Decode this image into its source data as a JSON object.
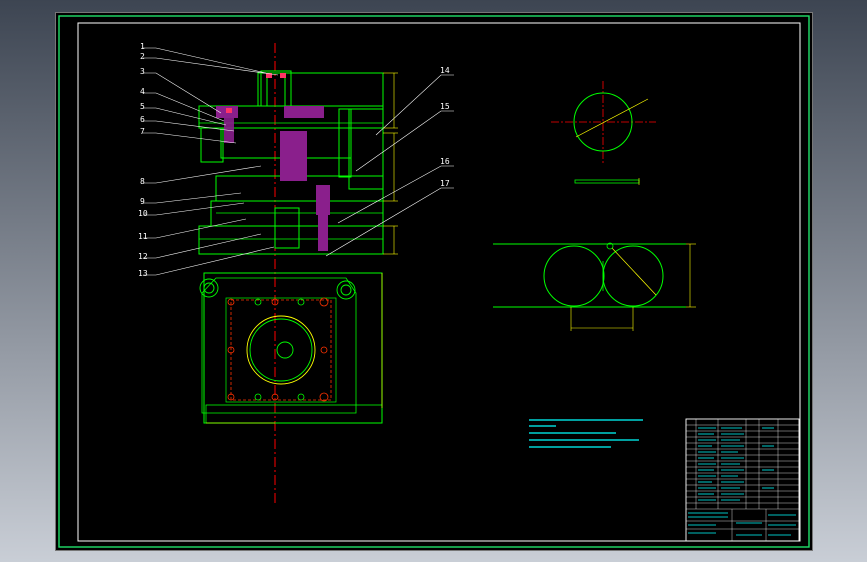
{
  "part_labels": [
    {
      "text": "1"
    },
    {
      "text": "2"
    },
    {
      "text": "3"
    },
    {
      "text": "4"
    },
    {
      "text": "5"
    },
    {
      "text": "6"
    },
    {
      "text": "7"
    },
    {
      "text": "8"
    },
    {
      "text": "9"
    },
    {
      "text": "10"
    },
    {
      "text": "11"
    },
    {
      "text": "12"
    },
    {
      "text": "13"
    },
    {
      "text": "14"
    },
    {
      "text": "15"
    },
    {
      "text": "16"
    },
    {
      "text": "17"
    }
  ],
  "colors": {
    "background": "#000000",
    "frame": "#ffffff",
    "part_outline": "#00ff00",
    "dimension": "#ffff00",
    "centerline": "#ff0000",
    "section_hatch": "#8a1f8c",
    "holes": "#ff3300",
    "notes": "#00ffff",
    "leaders": "#ffffff"
  },
  "icons": {
    "section_view": "die-section-view",
    "plan_view": "die-plan-view",
    "blank_circle": "blank-circle-detail",
    "layout_strip": "strip-layout-detail"
  }
}
